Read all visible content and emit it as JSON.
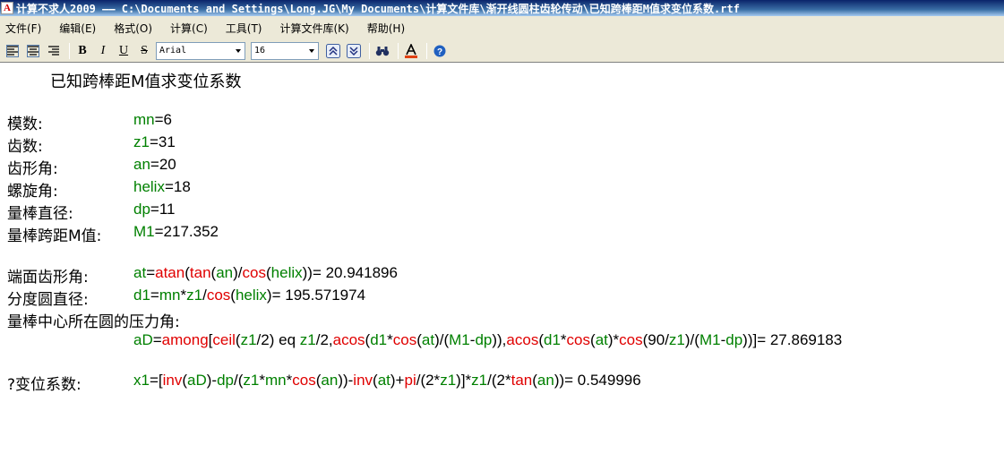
{
  "window": {
    "title": "计算不求人2009 —— C:\\Documents and Settings\\Long.JG\\My Documents\\计算文件库\\渐开线圆柱齿轮传动\\已知跨棒距M值求变位系数.rtf"
  },
  "menu": [
    "文件(F)",
    "编辑(E)",
    "格式(O)",
    "计算(C)",
    "工具(T)",
    "计算文件库(K)",
    "帮助(H)"
  ],
  "toolbar": {
    "bold": "B",
    "italic": "I",
    "underline": "U",
    "strike": "S",
    "font_name": "Arial",
    "font_size": "16"
  },
  "document": {
    "title": "已知跨棒距M值求变位系数",
    "params": [
      {
        "label": "模数:",
        "parts": [
          {
            "t": "mn",
            "c": "v"
          },
          {
            "t": "=6",
            "c": "k"
          }
        ]
      },
      {
        "label": "齿数:",
        "parts": [
          {
            "t": "z1",
            "c": "v"
          },
          {
            "t": "=31",
            "c": "k"
          }
        ]
      },
      {
        "label": "齿形角:",
        "parts": [
          {
            "t": "an",
            "c": "v"
          },
          {
            "t": "=20",
            "c": "k"
          }
        ]
      },
      {
        "label": "螺旋角:",
        "parts": [
          {
            "t": "helix",
            "c": "v"
          },
          {
            "t": "=18",
            "c": "k"
          }
        ]
      },
      {
        "label": "量棒直径:",
        "parts": [
          {
            "t": "dp",
            "c": "v"
          },
          {
            "t": "=11",
            "c": "k"
          }
        ]
      },
      {
        "label": "量棒跨距M值:",
        "parts": [
          {
            "t": "M1",
            "c": "v"
          },
          {
            "t": "=217.352",
            "c": "k"
          }
        ]
      }
    ],
    "calcs": [
      {
        "label": "端面齿形角:",
        "parts": [
          {
            "t": "at",
            "c": "v"
          },
          {
            "t": "=",
            "c": "k"
          },
          {
            "t": "atan",
            "c": "f"
          },
          {
            "t": "(",
            "c": "k"
          },
          {
            "t": "tan",
            "c": "f"
          },
          {
            "t": "(",
            "c": "k"
          },
          {
            "t": "an",
            "c": "v"
          },
          {
            "t": ")/",
            "c": "k"
          },
          {
            "t": "cos",
            "c": "f"
          },
          {
            "t": "(",
            "c": "k"
          },
          {
            "t": "helix",
            "c": "v"
          },
          {
            "t": "))= 20.941896",
            "c": "k"
          }
        ]
      },
      {
        "label": "分度圆直径:",
        "parts": [
          {
            "t": "d1",
            "c": "v"
          },
          {
            "t": "=",
            "c": "k"
          },
          {
            "t": "mn",
            "c": "v"
          },
          {
            "t": "*",
            "c": "k"
          },
          {
            "t": "z1",
            "c": "v"
          },
          {
            "t": "/",
            "c": "k"
          },
          {
            "t": "cos",
            "c": "f"
          },
          {
            "t": "(",
            "c": "k"
          },
          {
            "t": "helix",
            "c": "v"
          },
          {
            "t": ")= 195.571974",
            "c": "k"
          }
        ]
      }
    ],
    "pressure_label": "量棒中心所在圆的压力角:",
    "pressure_expr": [
      {
        "t": "aD",
        "c": "v"
      },
      {
        "t": "=",
        "c": "k"
      },
      {
        "t": "among",
        "c": "f"
      },
      {
        "t": "[",
        "c": "k"
      },
      {
        "t": "ceil",
        "c": "f"
      },
      {
        "t": "(",
        "c": "k"
      },
      {
        "t": "z1",
        "c": "v"
      },
      {
        "t": "/2) eq ",
        "c": "k"
      },
      {
        "t": "z1",
        "c": "v"
      },
      {
        "t": "/2,",
        "c": "k"
      },
      {
        "t": "acos",
        "c": "f"
      },
      {
        "t": "(",
        "c": "k"
      },
      {
        "t": "d1",
        "c": "v"
      },
      {
        "t": "*",
        "c": "k"
      },
      {
        "t": "cos",
        "c": "f"
      },
      {
        "t": "(",
        "c": "k"
      },
      {
        "t": "at",
        "c": "v"
      },
      {
        "t": ")/(",
        "c": "k"
      },
      {
        "t": "M1",
        "c": "v"
      },
      {
        "t": "-",
        "c": "k"
      },
      {
        "t": "dp",
        "c": "v"
      },
      {
        "t": ")),",
        "c": "k"
      },
      {
        "t": "acos",
        "c": "f"
      },
      {
        "t": "(",
        "c": "k"
      },
      {
        "t": "d1",
        "c": "v"
      },
      {
        "t": "*",
        "c": "k"
      },
      {
        "t": "cos",
        "c": "f"
      },
      {
        "t": "(",
        "c": "k"
      },
      {
        "t": "at",
        "c": "v"
      },
      {
        "t": ")*",
        "c": "k"
      },
      {
        "t": "cos",
        "c": "f"
      },
      {
        "t": "(90/",
        "c": "k"
      },
      {
        "t": "z1",
        "c": "v"
      },
      {
        "t": ")/(",
        "c": "k"
      },
      {
        "t": "M1",
        "c": "v"
      },
      {
        "t": "-",
        "c": "k"
      },
      {
        "t": "dp",
        "c": "v"
      },
      {
        "t": "))]= 27.869183",
        "c": "k"
      }
    ],
    "shift_label": "?变位系数:",
    "shift_expr": [
      {
        "t": "x1",
        "c": "v"
      },
      {
        "t": "=[",
        "c": "k"
      },
      {
        "t": "inv",
        "c": "f"
      },
      {
        "t": "(",
        "c": "k"
      },
      {
        "t": "aD",
        "c": "v"
      },
      {
        "t": ")-",
        "c": "k"
      },
      {
        "t": "dp",
        "c": "v"
      },
      {
        "t": "/(",
        "c": "k"
      },
      {
        "t": "z1",
        "c": "v"
      },
      {
        "t": "*",
        "c": "k"
      },
      {
        "t": "mn",
        "c": "v"
      },
      {
        "t": "*",
        "c": "k"
      },
      {
        "t": "cos",
        "c": "f"
      },
      {
        "t": "(",
        "c": "k"
      },
      {
        "t": "an",
        "c": "v"
      },
      {
        "t": "))-",
        "c": "k"
      },
      {
        "t": "inv",
        "c": "f"
      },
      {
        "t": "(",
        "c": "k"
      },
      {
        "t": "at",
        "c": "v"
      },
      {
        "t": ")+",
        "c": "k"
      },
      {
        "t": "pi",
        "c": "f"
      },
      {
        "t": "/(2*",
        "c": "k"
      },
      {
        "t": "z1",
        "c": "v"
      },
      {
        "t": ")]*",
        "c": "k"
      },
      {
        "t": "z1",
        "c": "v"
      },
      {
        "t": "/(2*",
        "c": "k"
      },
      {
        "t": "tan",
        "c": "f"
      },
      {
        "t": "(",
        "c": "k"
      },
      {
        "t": "an",
        "c": "v"
      },
      {
        "t": "))= 0.549996",
        "c": "k"
      }
    ]
  },
  "colors": {
    "variable": "#008000",
    "function": "#e00000",
    "title_bar": "#0a246a",
    "menu_bg": "#ece9d8"
  }
}
